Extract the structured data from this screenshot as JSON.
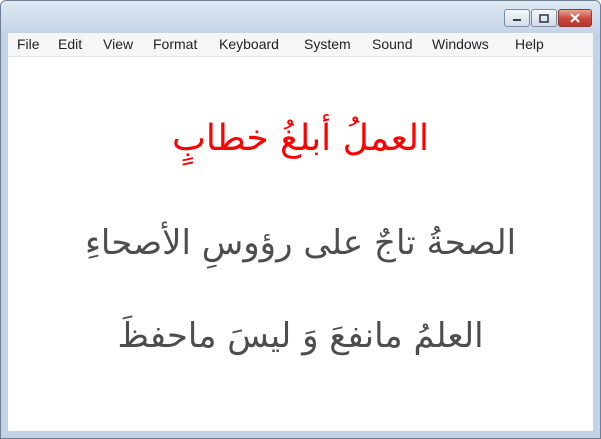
{
  "window": {
    "controls": {
      "minimize_icon": "minimize-icon",
      "maximize_icon": "maximize-icon",
      "close_icon": "close-icon"
    }
  },
  "menu": {
    "items": [
      "File",
      "Edit",
      "View",
      "Format",
      "Keyboard",
      "System",
      "Sound",
      "Windows",
      "Help"
    ]
  },
  "content": {
    "lines": [
      "العملُ أبلغُ خطابٍ",
      "الصحةُ تاجٌ على رؤوسِ الأصحاءِ",
      "العلمُ مانفعَ وَ ليسَ ماحفظَ"
    ]
  },
  "colors": {
    "line1": "#ff0000",
    "line1_diacritics": "#1e78ff",
    "line2": "#4d4d4d",
    "line2_diacritics": "#ff3333",
    "line3": "#4d4d4d",
    "line3_diacritics": "#ff3333"
  }
}
